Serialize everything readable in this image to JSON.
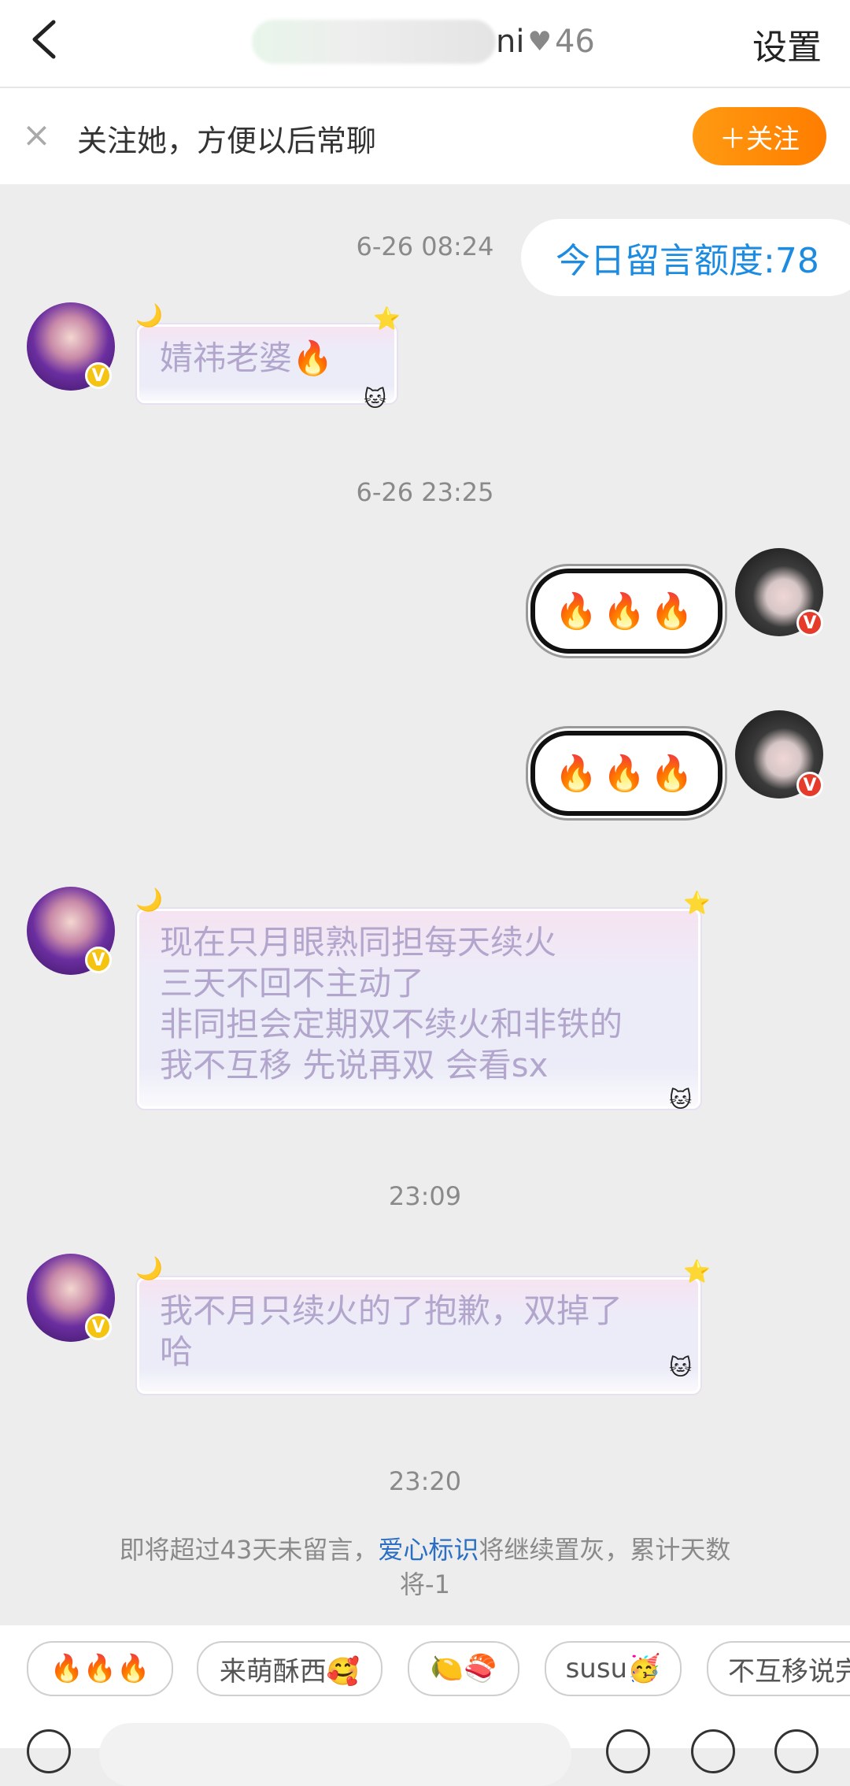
{
  "header": {
    "title_visible": "ni",
    "level": "46",
    "settings_label": "设置"
  },
  "follow_bar": {
    "text": "关注她，方便以后常聊",
    "button_label": "＋关注"
  },
  "quota": "今日留言额度:78",
  "messages": [
    {
      "timestamp": "6-26 08:24"
    },
    {
      "side": "left",
      "text": "婧祎老婆🔥"
    },
    {
      "timestamp": "6-26 23:25"
    },
    {
      "side": "right",
      "text": "🔥🔥🔥"
    },
    {
      "side": "right",
      "text": "🔥🔥🔥"
    },
    {
      "side": "left",
      "lines": [
        "现在只月眼熟同担每天续火",
        "三天不回不主动了",
        "非同担会定期双不续火和非铁的",
        "我不互移 先说再双 会看sx"
      ]
    },
    {
      "timestamp": "23:09"
    },
    {
      "side": "left",
      "lines": [
        "我不月只续火的了抱歉，双掉了",
        "哈"
      ]
    },
    {
      "timestamp": "23:20"
    }
  ],
  "notice": {
    "pre": "即将超过43天未留言，",
    "link": "爱心标识",
    "post": "将继续置灰，累计天数将-1"
  },
  "quick_replies": [
    "🔥🔥🔥",
    "来萌酥西🥰",
    "🍋🍣",
    "susu🥳",
    "不互移说完"
  ],
  "icons": {
    "back": "chevron-left-icon",
    "heart": "heart-icon",
    "close": "close-icon",
    "verified": "verified-badge-icon"
  },
  "colors": {
    "accent_orange": "#ff8a00",
    "quota_blue": "#1d8ce0",
    "link_blue": "#2a6fc4",
    "gold_badge": "#f5c312",
    "red_badge": "#e63a2a"
  }
}
